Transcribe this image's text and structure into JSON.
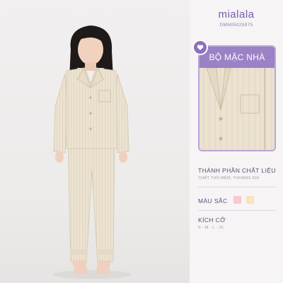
{
  "brand": {
    "name": "mialala",
    "product_code": "DMN05025975"
  },
  "card": {
    "title": "BỘ MẶC NHÀ",
    "icon": "heart-icon"
  },
  "details": {
    "material": {
      "title": "THÀNH PHẦN CHẤT LIỆU",
      "description": "CHẤT THÔ MỀM, THOÁNG KHÍ"
    },
    "colors": {
      "title": "MÀU SẮC",
      "swatches": [
        "#f6c9cf",
        "#f9e2bd"
      ]
    },
    "sizes": {
      "title": "KÍCH CỠ",
      "values": "S · M · L · XL"
    }
  },
  "colors": {
    "accent": "#9b82c6",
    "brand_text": "#7a5ab0",
    "fabric": "#ece3d2"
  }
}
